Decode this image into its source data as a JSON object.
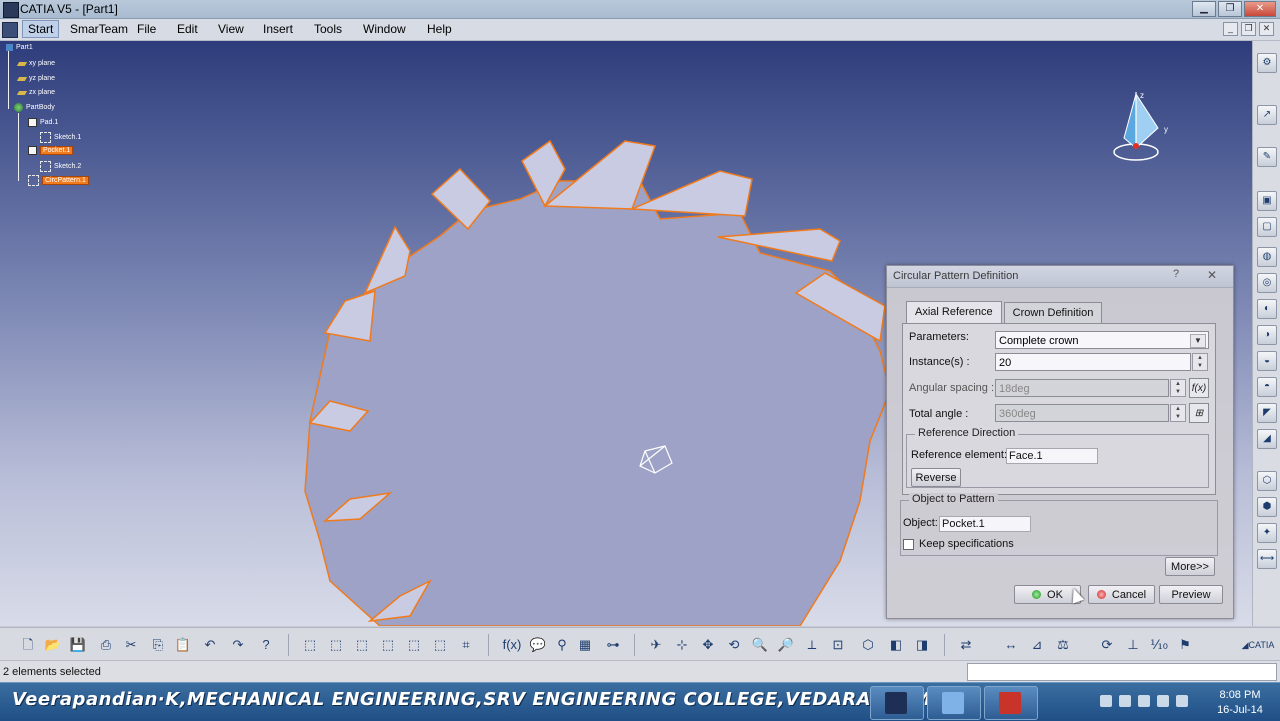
{
  "window": {
    "title": "CATIA V5 - [Part1]",
    "buttons": [
      "minimize",
      "maximize",
      "close"
    ]
  },
  "menu": {
    "items": [
      "Start",
      "SmarTeam",
      "File",
      "Edit",
      "View",
      "Insert",
      "Tools",
      "Window",
      "Help"
    ]
  },
  "tree": {
    "root": "Part1",
    "planes": [
      "xy plane",
      "yz plane",
      "zx plane"
    ],
    "body": "PartBody",
    "features": [
      {
        "label": "Pad.1",
        "selected": false
      },
      {
        "label": "Sketch.1",
        "selected": false
      },
      {
        "label": "Pocket.1",
        "selected": true
      },
      {
        "label": "Sketch.2",
        "selected": false
      },
      {
        "label": "CircPattern.1",
        "selected": true
      }
    ]
  },
  "compass": {
    "labels": [
      "z",
      "y"
    ]
  },
  "dialog": {
    "title": "Circular Pattern Definition",
    "tabs": [
      "Axial Reference",
      "Crown Definition"
    ],
    "active_tab": "Axial Reference",
    "parameters_label": "Parameters:",
    "parameters_value": "Complete crown",
    "instances_label": "Instance(s) :",
    "instances_value": "20",
    "angular_spacing_label": "Angular spacing :",
    "angular_spacing_value": "18deg",
    "total_angle_label": "Total angle :",
    "total_angle_value": "360deg",
    "reference_direction_title": "Reference Direction",
    "reference_element_label": "Reference element:",
    "reference_element_value": "Face.1",
    "reverse_label": "Reverse",
    "object_to_pattern_title": "Object to Pattern",
    "object_label": "Object:",
    "object_value": "Pocket.1",
    "keep_specifications_label": "Keep specifications",
    "keep_specifications_checked": false,
    "more_label": "More>>",
    "ok_label": "OK",
    "cancel_label": "Cancel",
    "preview_label": "Preview"
  },
  "status": {
    "message": "2 elements selected"
  },
  "taskbar": {
    "caption": "Veerapandian·K,MECHANICAL ENGINEERING,SRV ENGINEERING COLLEGE,VEDARANYAM·",
    "time": "8:08 PM",
    "date": "16-Jul-14"
  },
  "colors": {
    "viewport_top": "#2e3c7b",
    "viewport_bottom": "#d8dbe8",
    "gear_face": "#9ea2c6",
    "highlight": "#f07a1c",
    "selection": "#f07a1c"
  }
}
